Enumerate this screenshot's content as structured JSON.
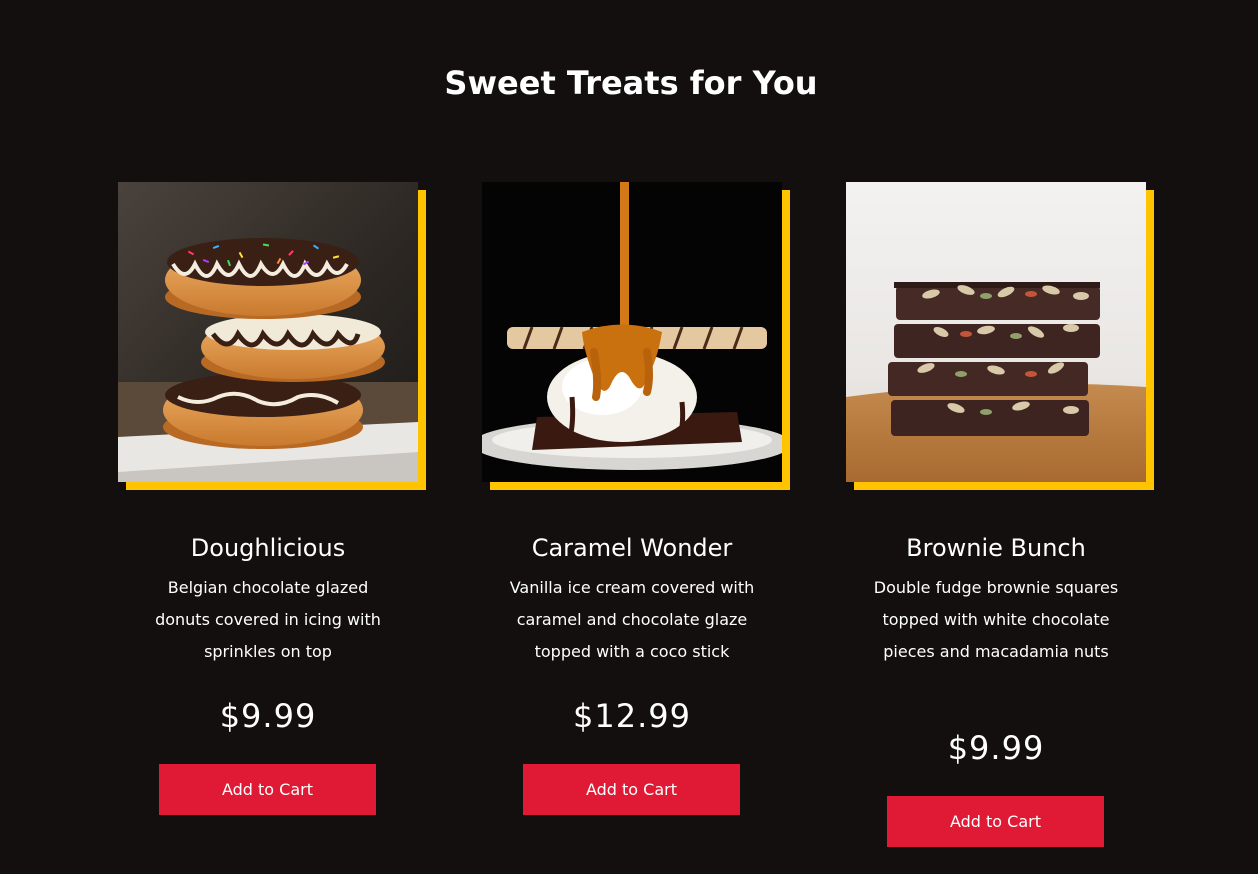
{
  "page": {
    "title": "Sweet Treats for You"
  },
  "colors": {
    "background": "#130f0f",
    "accent": "#ffc300",
    "button": "#e01a35",
    "text": "#ffffff"
  },
  "products": [
    {
      "image_icon": "stacked-donuts-photo",
      "name": "Doughlicious",
      "description": "Belgian chocolate glazed donuts covered in icing with sprinkles on top",
      "price": "$9.99",
      "button_label": "Add to Cart"
    },
    {
      "image_icon": "caramel-ice-cream-photo",
      "name": "Caramel Wonder",
      "description": "Vanilla ice cream covered with caramel and chocolate glaze topped with a coco stick",
      "price": "$12.99",
      "button_label": "Add to Cart"
    },
    {
      "image_icon": "brownie-stack-photo",
      "name": "Brownie Bunch",
      "description": "Double fudge brownie squares topped with white chocolate pieces and macadamia nuts",
      "price": "$9.99",
      "button_label": "Add to Cart"
    }
  ]
}
